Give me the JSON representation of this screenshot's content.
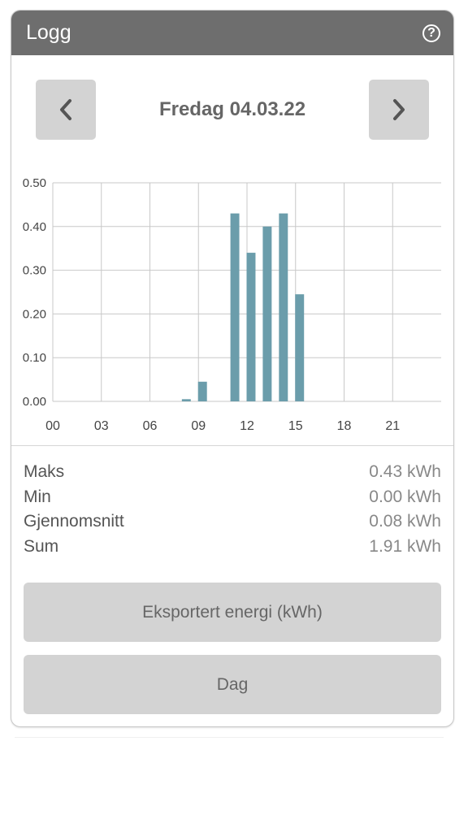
{
  "header": {
    "title": "Logg",
    "help_icon": "help-circle-icon"
  },
  "nav": {
    "date": "Fredag 04.03.22",
    "prev_icon": "chevron-left-icon",
    "next_icon": "chevron-right-icon"
  },
  "chart_data": {
    "type": "bar",
    "title": "",
    "xlabel": "",
    "ylabel": "",
    "x_tick_labels": [
      "00",
      "03",
      "06",
      "09",
      "12",
      "15",
      "18",
      "21"
    ],
    "y_tick_labels": [
      "0.00",
      "0.10",
      "0.20",
      "0.30",
      "0.40",
      "0.50"
    ],
    "ylim": [
      0,
      0.5
    ],
    "xlim": [
      0,
      24
    ],
    "grid": true,
    "bar_color": "#6b9dab",
    "hours": [
      8,
      9,
      11,
      12,
      13,
      14,
      15
    ],
    "values": [
      0.005,
      0.045,
      0.43,
      0.34,
      0.4,
      0.43,
      0.245
    ]
  },
  "stats": [
    {
      "label": "Maks",
      "value": "0.43 kWh"
    },
    {
      "label": "Min",
      "value": "0.00 kWh"
    },
    {
      "label": "Gjennomsnitt",
      "value": "0.08 kWh"
    },
    {
      "label": "Sum",
      "value": "1.91 kWh"
    }
  ],
  "buttons": {
    "energy_type": "Eksportert energi (kWh)",
    "period": "Dag"
  },
  "colors": {
    "header_bg": "#6e6e6e",
    "button_bg": "#d3d3d3",
    "bar": "#6b9dab"
  }
}
